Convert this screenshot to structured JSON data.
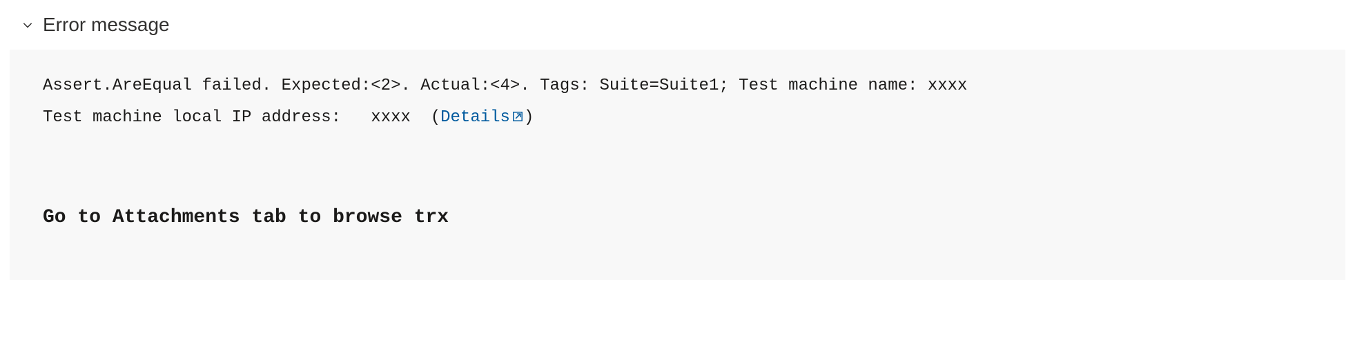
{
  "section": {
    "title": "Error message"
  },
  "error": {
    "line1_part1": "Assert.AreEqual failed. Expected:<2>. Actual:<4>. Tags: Suite=Suite1; Test machine name: ",
    "line1_redacted": "xxxx",
    "line2_part1": "Test machine local IP address: ",
    "line2_redacted": "xxxx",
    "details_open_paren": "  (",
    "details_label": "Details",
    "details_close_paren": ")"
  },
  "instruction": {
    "text": "Go to Attachments tab to browse trx"
  }
}
